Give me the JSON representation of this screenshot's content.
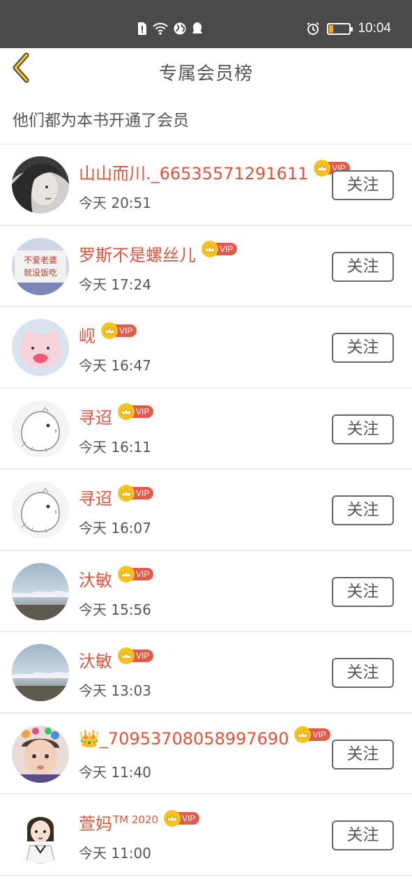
{
  "status_bar": {
    "time": "10:04"
  },
  "header": {
    "title": "专属会员榜"
  },
  "subtitle": "他们都为本书开通了会员",
  "vip_label": "VIP",
  "follow_label": "关注",
  "colors": {
    "accent": "#e0533b",
    "vip_tag": "#e25a4a",
    "crown": "#f7c21e",
    "back_arrow": "#f0c419"
  },
  "members": [
    {
      "name": "山山而川._66535571291611",
      "time": "今天 20:51",
      "avatar": "girl-photo"
    },
    {
      "name": "罗斯不是螺丝儿",
      "time": "今天 17:24",
      "avatar": "text-sign",
      "avatar_text": "不爱老婆\n就没饭吃"
    },
    {
      "name": "岘",
      "time": "今天 16:47",
      "avatar": "pink-bunny"
    },
    {
      "name": "寻迢",
      "time": "今天 16:11",
      "avatar": "sketch-hamster"
    },
    {
      "name": "寻迢",
      "time": "今天 16:07",
      "avatar": "sketch-hamster"
    },
    {
      "name": "汏敏",
      "time": "今天 15:56",
      "avatar": "sky-clouds"
    },
    {
      "name": "汏敏",
      "time": "今天 13:03",
      "avatar": "sky-clouds"
    },
    {
      "name": "👑_70953708058997690",
      "time": "今天 11:40",
      "avatar": "baby-photo"
    },
    {
      "name": "萱妈",
      "name_suffix": "TM 2020",
      "time": "今天 11:00",
      "avatar": "cartoon-girl"
    }
  ]
}
